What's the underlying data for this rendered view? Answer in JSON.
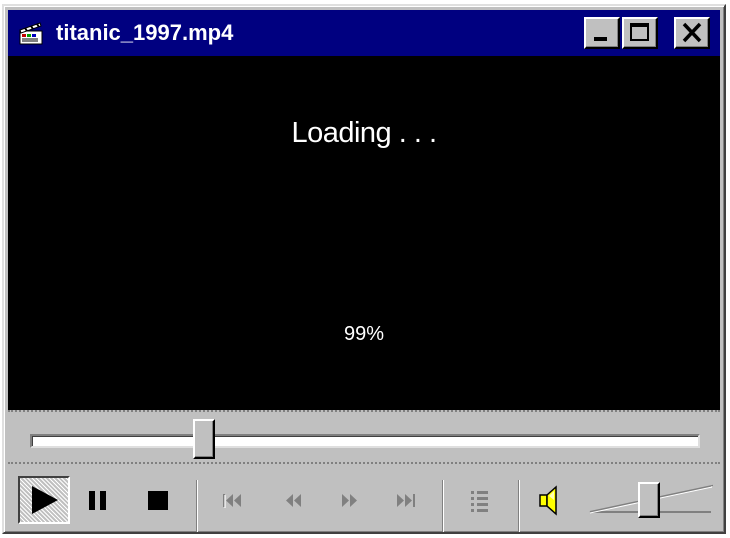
{
  "window": {
    "title": "titanic_1997.mp4",
    "app_icon": "clapperboard-icon",
    "controls": [
      "minimize-icon",
      "maximize-icon",
      "close-icon"
    ]
  },
  "video": {
    "status_text": "Loading . . .",
    "progress_text": "99%",
    "progress_value": 0.99
  },
  "seek": {
    "position_fraction": 0.26
  },
  "transport": {
    "buttons": [
      {
        "name": "play",
        "icon": "play-icon",
        "state": "pressed"
      },
      {
        "name": "pause",
        "icon": "pause-icon",
        "state": "enabled"
      },
      {
        "name": "stop",
        "icon": "stop-icon",
        "state": "enabled"
      },
      {
        "name": "skip-back",
        "icon": "skip-back-icon",
        "state": "disabled"
      },
      {
        "name": "rewind",
        "icon": "rewind-icon",
        "state": "disabled"
      },
      {
        "name": "fast-forward",
        "icon": "fast-forward-icon",
        "state": "disabled"
      },
      {
        "name": "skip-forward",
        "icon": "skip-forward-icon",
        "state": "disabled"
      },
      {
        "name": "playlist",
        "icon": "playlist-icon",
        "state": "disabled"
      }
    ]
  },
  "volume": {
    "icon": "speaker-icon",
    "level_fraction": 0.48
  },
  "colors": {
    "titlebar": "#000080",
    "face": "#c0c0c0",
    "video_bg": "#000000",
    "text_on_dark": "#ffffff",
    "disabled_icon": "#808080",
    "speaker": "#ffff00"
  }
}
